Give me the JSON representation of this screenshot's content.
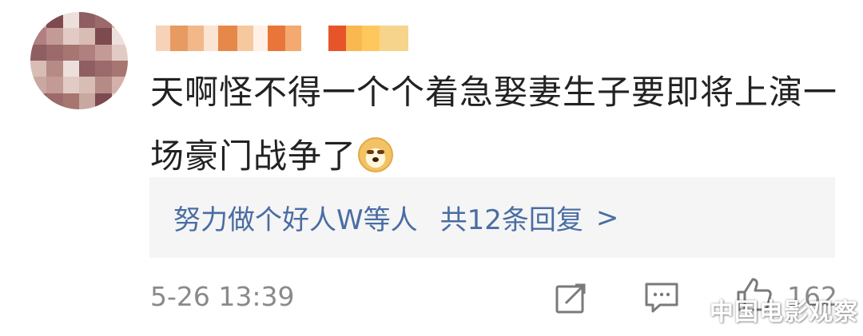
{
  "comment": {
    "text": "天啊怪不得一个个着急娶妻生子要即将上演一场豪门战争了",
    "emoji": "doge-emoji"
  },
  "replies": {
    "replier": "努力做个好人W等人",
    "count_label": "共12条回复",
    "chevron": ">"
  },
  "footer": {
    "timestamp": "5-26 13:39",
    "share_icon": "share-icon",
    "comment_icon": "comment-icon",
    "like_icon": "thumbs-up-icon",
    "like_count": "162"
  },
  "watermark": "中国电影观察",
  "colors": {
    "link_blue": "#4a6da3",
    "text": "#222222",
    "meta_gray": "#8a8a8a",
    "reply_bg": "#f5f5f5"
  }
}
